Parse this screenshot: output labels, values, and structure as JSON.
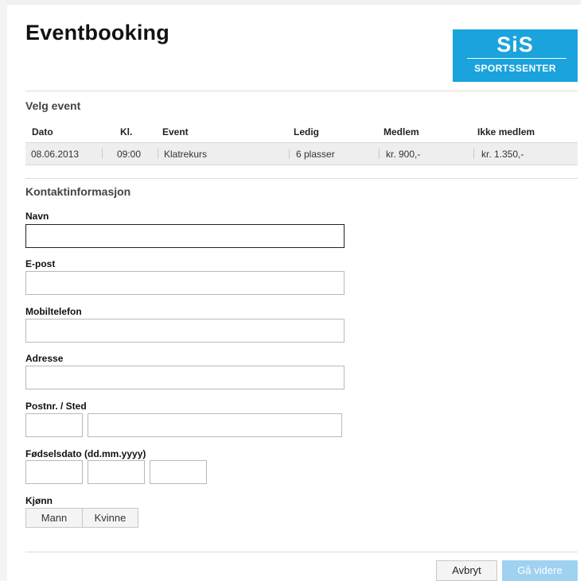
{
  "header": {
    "title": "Eventbooking",
    "logo": {
      "main": "SiS",
      "sub": "SPORTSSENTER",
      "color": "#1aa3dc"
    }
  },
  "event_section": {
    "title": "Velg event",
    "columns": [
      "Dato",
      "Kl.",
      "Event",
      "Ledig",
      "Medlem",
      "Ikke medlem"
    ],
    "row": {
      "date": "08.06.2013",
      "time": "09:00",
      "event": "Klatrekurs",
      "available": "6 plasser",
      "member_price": "kr. 900,-",
      "non_member_price": "kr. 1.350,-"
    }
  },
  "contact_section": {
    "title": "Kontaktinformasjon",
    "fields": {
      "name": {
        "label": "Navn",
        "value": ""
      },
      "email": {
        "label": "E-post",
        "value": ""
      },
      "mobile": {
        "label": "Mobiltelefon",
        "value": ""
      },
      "address": {
        "label": "Adresse",
        "value": ""
      },
      "postal": {
        "label": "Postnr. / Sted",
        "value": ""
      },
      "birthdate": {
        "label": "Fødselsdato (dd.mm.yyyy)",
        "value": ""
      }
    },
    "gender": {
      "label": "Kjønn",
      "options": [
        "Mann",
        "Kvinne"
      ]
    }
  },
  "actions": {
    "cancel": "Avbryt",
    "next": "Gå videre",
    "next_color": "#9fd1f0"
  }
}
